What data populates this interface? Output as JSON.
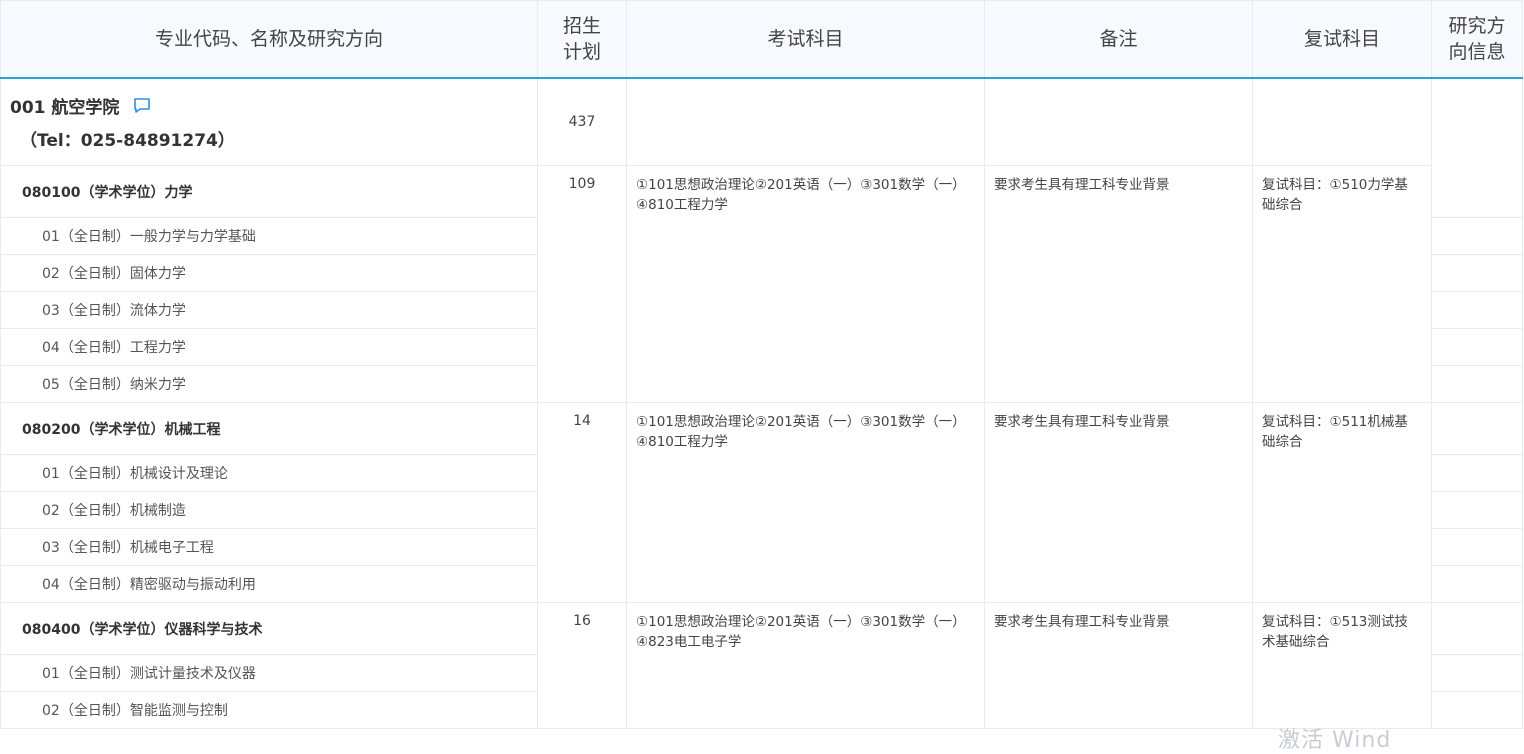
{
  "header": {
    "col_major": "专业代码、名称及研究方向",
    "col_plan_line1": "招生",
    "col_plan_line2": "计划",
    "col_exam": "考试科目",
    "col_remark": "备注",
    "col_retest": "复试科目",
    "col_info_line1": "研究方",
    "col_info_line2": "向信息"
  },
  "college": {
    "name": "001 航空学院",
    "tel": "（Tel：025-84891274）",
    "plan": "437"
  },
  "majors": [
    {
      "title": "080100（学术学位）力学",
      "plan": "109",
      "exam_line1": "①101思想政治理论②201英语（一）③301数学（一）",
      "exam_line2": "④810工程力学",
      "remark": "要求考生具有理工科专业背景",
      "retest_line1": "复试科目：①510力学基",
      "retest_line2": "础综合",
      "directions": [
        "01（全日制）一般力学与力学基础",
        "02（全日制）固体力学",
        "03（全日制）流体力学",
        "04（全日制）工程力学",
        "05（全日制）纳米力学"
      ]
    },
    {
      "title": "080200（学术学位）机械工程",
      "plan": "14",
      "exam_line1": "①101思想政治理论②201英语（一）③301数学（一）",
      "exam_line2": "④810工程力学",
      "remark": "要求考生具有理工科专业背景",
      "retest_line1": "复试科目：①511机械基",
      "retest_line2": "础综合",
      "directions": [
        "01（全日制）机械设计及理论",
        "02（全日制）机械制造",
        "03（全日制）机械电子工程",
        "04（全日制）精密驱动与振动利用"
      ]
    },
    {
      "title": "080400（学术学位）仪器科学与技术",
      "plan": "16",
      "exam_line1": "①101思想政治理论②201英语（一）③301数学（一）",
      "exam_line2": "④823电工电子学",
      "remark": "要求考生具有理工科专业背景",
      "retest_line1": "复试科目：①513测试技",
      "retest_line2": "术基础综合",
      "directions": [
        "01（全日制）测试计量技术及仪器",
        "02（全日制）智能监测与控制"
      ]
    }
  ],
  "watermark": "激活 Wind"
}
